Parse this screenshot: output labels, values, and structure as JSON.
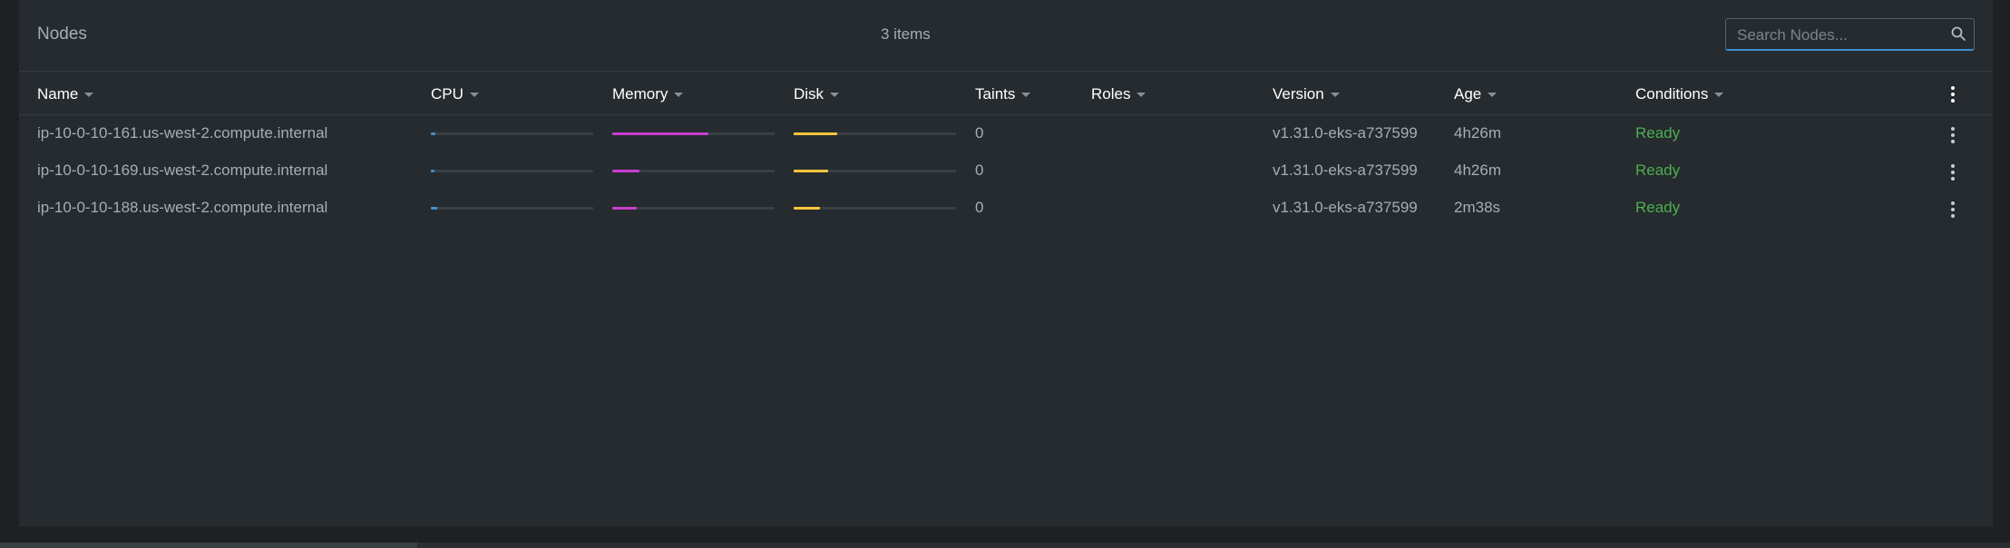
{
  "header": {
    "title": "Nodes",
    "count": "3 items",
    "search_placeholder": "Search Nodes..."
  },
  "columns": {
    "name": "Name",
    "cpu": "CPU",
    "memory": "Memory",
    "disk": "Disk",
    "taints": "Taints",
    "roles": "Roles",
    "version": "Version",
    "age": "Age",
    "conditions": "Conditions"
  },
  "colors": {
    "cpu": "#3d90ce",
    "memory": "#c93dce",
    "disk": "#ffc63d",
    "ready": "#4caf50",
    "search_focus": "#3d90ce"
  },
  "icons": {
    "search": "search-icon",
    "menu": "more-vertical-icon",
    "sort": "caret-down-icon"
  },
  "rows": [
    {
      "name": "ip-10-0-10-161.us-west-2.compute.internal",
      "cpu": 0.03,
      "memory": 0.59,
      "disk": 0.27,
      "taints": "0",
      "roles": "",
      "version": "v1.31.0-eks-a737599",
      "age": "4h26m",
      "conditions": "Ready"
    },
    {
      "name": "ip-10-0-10-169.us-west-2.compute.internal",
      "cpu": 0.02,
      "memory": 0.17,
      "disk": 0.21,
      "taints": "0",
      "roles": "",
      "version": "v1.31.0-eks-a737599",
      "age": "4h26m",
      "conditions": "Ready"
    },
    {
      "name": "ip-10-0-10-188.us-west-2.compute.internal",
      "cpu": 0.04,
      "memory": 0.15,
      "disk": 0.16,
      "taints": "0",
      "roles": "",
      "version": "v1.31.0-eks-a737599",
      "age": "2m38s",
      "conditions": "Ready"
    }
  ]
}
